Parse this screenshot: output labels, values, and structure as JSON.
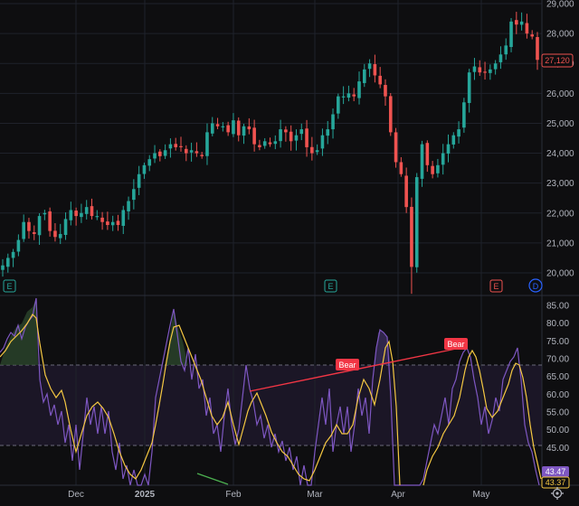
{
  "colors": {
    "background": "#0e0e10",
    "grid": "#2a2e39",
    "up": "#26a69a",
    "down": "#ef5350",
    "rsi_line": "#7e57c2",
    "rsi_ma": "#f5c842",
    "bear": "#f23645",
    "bull_div": "#4caf50",
    "price_tag": "#2962ff"
  },
  "price_axis": {
    "labels": [
      "29,000",
      "28,000",
      "27,000",
      "26,000",
      "25,000",
      "24,000",
      "23,000",
      "22,000",
      "21,000",
      "20,000"
    ],
    "current_price": "27,120"
  },
  "rsi_axis": {
    "labels": [
      "85.00",
      "80.00",
      "75.00",
      "70.00",
      "65.00",
      "60.00",
      "55.00",
      "50.00",
      "45.00"
    ],
    "value_rsi": "43.47",
    "value_ma": "43.37"
  },
  "x_axis": {
    "labels": [
      "Dec",
      "2025",
      "Feb",
      "Mar",
      "Apr",
      "May"
    ]
  },
  "earnings": [
    "E",
    "E",
    "E",
    "D"
  ],
  "annotations": {
    "bear_1": "Bear",
    "bear_2": "Bear"
  },
  "icons": {
    "settings": "gear-icon"
  },
  "chart_data": {
    "type": "candlestick",
    "price_range": [
      20000,
      29000
    ],
    "rsi_range": [
      40,
      85
    ],
    "rsi_bands": [
      50,
      70
    ],
    "x": [
      "Dec",
      "2025",
      "Feb",
      "Mar",
      "Apr",
      "May"
    ],
    "series": [
      {
        "values": [
          20250,
          20500,
          20700,
          21100,
          21700,
          21400,
          21300,
          21900,
          22000,
          21400,
          21200,
          21300,
          21800,
          22100,
          21900,
          22000,
          22200,
          21900,
          21900,
          21700,
          21600,
          21700,
          21600,
          22100,
          22400,
          22800,
          23300,
          23600,
          23800,
          24000,
          23900,
          24100,
          24300,
          24200,
          24200,
          24000,
          24100,
          24000,
          23900,
          24700,
          25000,
          24900,
          24900,
          24700,
          25100,
          24600,
          24900,
          24800,
          24300,
          24200,
          24400,
          24300,
          24400,
          24800,
          24700,
          24400,
          24600,
          24800,
          24200,
          24000,
          24100,
          24600,
          24800,
          25300,
          25900,
          25900,
          26000,
          25900,
          26400,
          26800,
          27000,
          26600,
          26300,
          25900,
          24700,
          23700,
          23300,
          22200,
          20200,
          23200,
          24300,
          23600,
          23300,
          23600,
          24000,
          24300,
          24600,
          24800,
          25700,
          26700,
          26900,
          26700,
          26700,
          26800,
          27000,
          27300,
          27600,
          28400,
          28300,
          28400,
          28000,
          27900,
          27120
        ]
      }
    ]
  }
}
